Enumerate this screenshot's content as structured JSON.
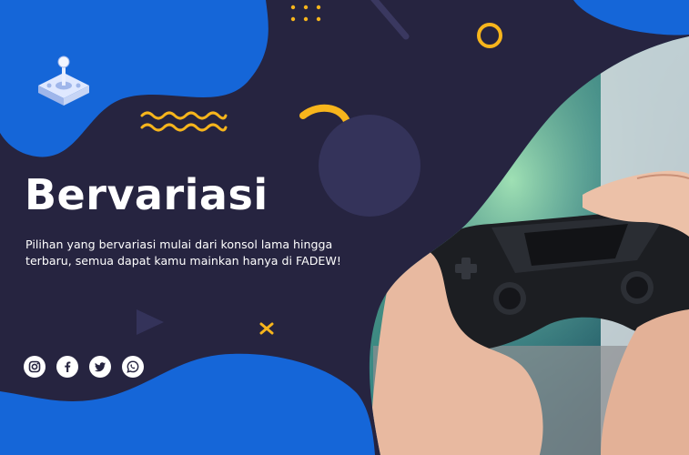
{
  "banner": {
    "title": "Bervariasi",
    "description": "Pilihan yang bervariasi mulai dari konsol lama hingga terbaru, semua dapat kamu mainkan hanya di FADEW!"
  },
  "social": {
    "items": [
      {
        "icon": "instagram-icon"
      },
      {
        "icon": "facebook-icon"
      },
      {
        "icon": "twitter-icon"
      },
      {
        "icon": "whatsapp-icon"
      }
    ]
  },
  "colors": {
    "background": "#262440",
    "brand_blue": "#1566d8",
    "accent_yellow": "#f7b51c",
    "text": "#ffffff"
  }
}
